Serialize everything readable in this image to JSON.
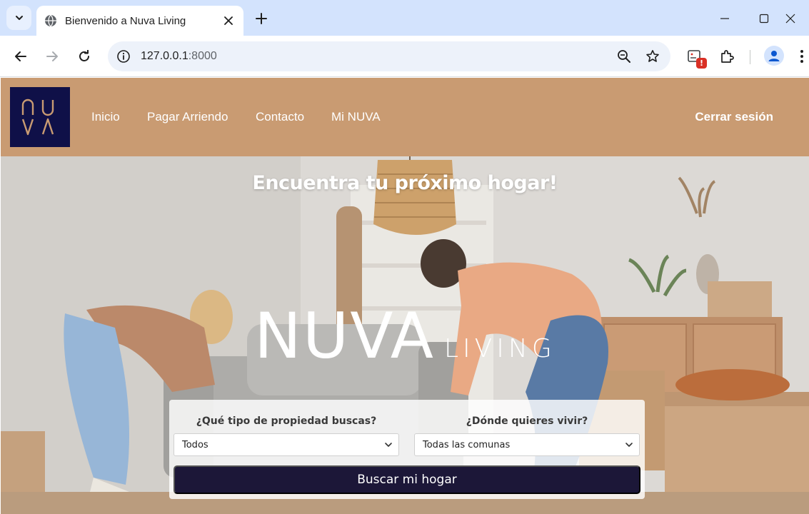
{
  "browser": {
    "tab": {
      "title": "Bienvenido a Nuva Living"
    },
    "address": {
      "host": "127.0.0.1",
      "port": ":8000"
    },
    "extension_badge": "!"
  },
  "header": {
    "logo_text": "NUVA",
    "nav": [
      "Inicio",
      "Pagar Arriendo",
      "Contacto",
      "Mi NUVA"
    ],
    "logout_label": "Cerrar sesión",
    "colors": {
      "bar": "#c99b72",
      "logo_bg": "#0f1048",
      "logo_letters": "#c99b72"
    }
  },
  "hero": {
    "title": "Encuentra tu próximo hogar!",
    "wordmark_main": "NUVA",
    "wordmark_sub": "LIVING"
  },
  "search": {
    "property_type": {
      "label": "¿Qué tipo de propiedad buscas?",
      "value": "Todos"
    },
    "location": {
      "label": "¿Dónde quieres vivir?",
      "value": "Todas las comunas"
    },
    "submit_label": "Buscar mi hogar",
    "colors": {
      "button": "#1c1738"
    }
  }
}
